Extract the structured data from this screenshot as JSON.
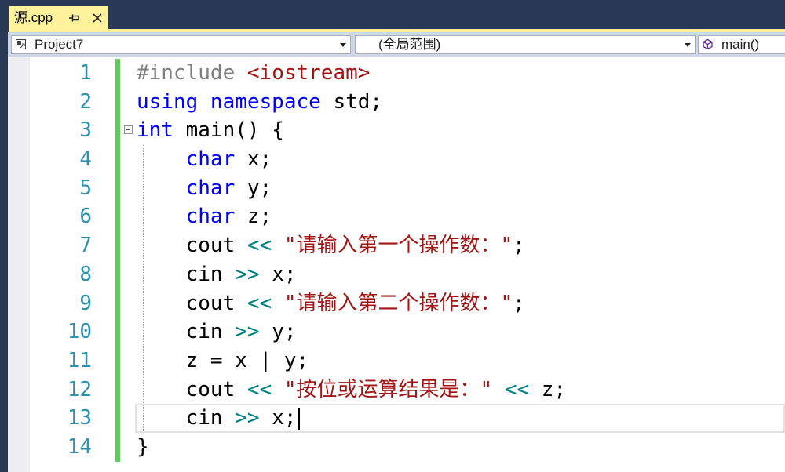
{
  "document_tab": {
    "title": "源.cpp",
    "pin_icon": "pin-icon",
    "close_icon": "close-icon"
  },
  "navigation_bar": {
    "project_dropdown": {
      "value": "Project7",
      "icon": "project-icon"
    },
    "scope_dropdown": {
      "value": "(全局范围)"
    },
    "member_dropdown": {
      "value": "main()",
      "icon": "method-icon"
    }
  },
  "editor": {
    "current_line": 13,
    "lines": [
      {
        "number": "1",
        "code": [
          "#include ",
          "<iostream>"
        ]
      },
      {
        "number": "2",
        "code": [
          "using namespace",
          " std;"
        ]
      },
      {
        "number": "3",
        "code": [
          "int",
          " main() {"
        ]
      },
      {
        "number": "4",
        "code": [
          "char",
          " x;"
        ]
      },
      {
        "number": "5",
        "code": [
          "char",
          " y;"
        ]
      },
      {
        "number": "6",
        "code": [
          "char",
          " z;"
        ]
      },
      {
        "number": "7",
        "code": [
          "cout ",
          "<<",
          " \"请输入第一个操作数：\"",
          ";"
        ]
      },
      {
        "number": "8",
        "code": [
          "cin ",
          ">>",
          " x;"
        ]
      },
      {
        "number": "9",
        "code": [
          "cout ",
          "<<",
          " \"请输入第二个操作数：\"",
          ";"
        ]
      },
      {
        "number": "10",
        "code": [
          "cin ",
          ">>",
          " y;"
        ]
      },
      {
        "number": "11",
        "code": [
          "z = x | y;"
        ]
      },
      {
        "number": "12",
        "code": [
          "cout ",
          "<<",
          " \"按位或运算结果是：\" ",
          "<<",
          " z;"
        ]
      },
      {
        "number": "13",
        "code": [
          "cin ",
          ">>",
          " x;"
        ]
      },
      {
        "number": "14",
        "code": [
          "}"
        ]
      }
    ]
  },
  "theme": {
    "chrome": "#293955",
    "tab": "#FFF29D",
    "navbar": "#CFD6E5",
    "keyword": "#0000FF",
    "preprocessor": "#808080",
    "string": "#A31515",
    "operator": "#008080",
    "plain": "#000000",
    "line-number": "#2B91AF",
    "change-bar": "#5FCB5F"
  }
}
